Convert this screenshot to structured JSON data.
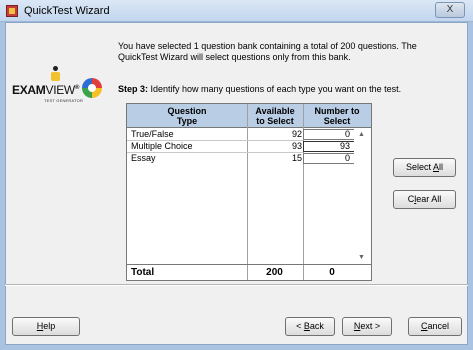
{
  "window": {
    "title": "QuickTest Wizard",
    "close_label": "X"
  },
  "logo": {
    "brand_bold": "EXAM",
    "brand_light": "VIEW",
    "registered": "®",
    "tagline": "TEST GENERATOR"
  },
  "intro": {
    "text": "You have selected 1 question bank containing a total of 200 questions.  The QuickTest Wizard will select questions only from this bank."
  },
  "step": {
    "label": "Step 3:",
    "text": "  Identify how many questions of each type you want on the test."
  },
  "grid": {
    "headers": {
      "type_line1": "Question",
      "type_line2": "Type",
      "avail_line1": "Available",
      "avail_line2": "to Select",
      "num_line1": "Number to",
      "num_line2": "Select"
    },
    "rows": [
      {
        "type": "True/False",
        "available": "92",
        "selected": "0"
      },
      {
        "type": "Multiple Choice",
        "available": "93",
        "selected": "93"
      },
      {
        "type": "Essay",
        "available": "15",
        "selected": "0"
      }
    ],
    "total": {
      "label": "Total",
      "available": "200",
      "selected": "0"
    }
  },
  "side_buttons": {
    "select_all_prefix": "Select ",
    "select_all_key": "A",
    "select_all_suffix": "ll",
    "clear_all_prefix": "C",
    "clear_all_key": "l",
    "clear_all_suffix": "ear All"
  },
  "footer_buttons": {
    "help_key": "H",
    "help_rest": "elp",
    "back_prefix": "< ",
    "back_key": "B",
    "back_rest": "ack",
    "next_key": "N",
    "next_rest": "ext >",
    "cancel_key": "C",
    "cancel_rest": "ancel"
  },
  "colors": {
    "header_bg": "#b9cde5",
    "window_frame": "#a9c3e0"
  }
}
